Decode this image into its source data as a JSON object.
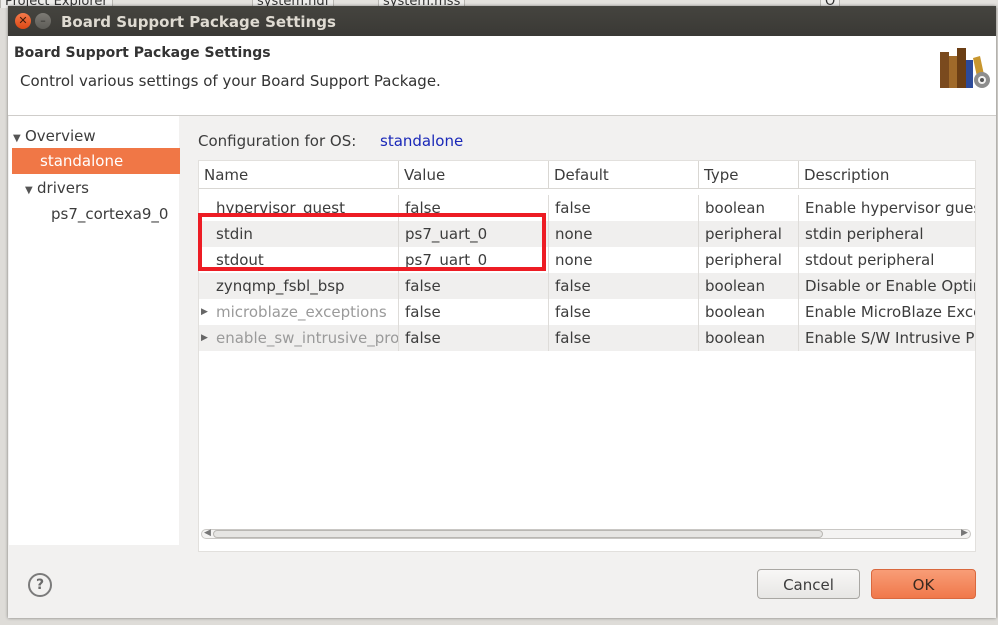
{
  "background": {
    "tabs": [
      "Project Explorer",
      "system.hdf",
      "system.mss",
      "O"
    ]
  },
  "dialog": {
    "title": "Board Support Package Settings",
    "header_title": "Board Support Package Settings",
    "header_description": "Control various settings of your Board Support Package."
  },
  "tree": {
    "items": [
      {
        "label": "Overview",
        "expanded": true,
        "level": 0
      },
      {
        "label": "standalone",
        "selected": true,
        "level": 1
      },
      {
        "label": "drivers",
        "expanded": true,
        "level": 1
      },
      {
        "label": "ps7_cortexa9_0",
        "level": 2
      }
    ]
  },
  "config": {
    "label": "Configuration for OS:",
    "os": "standalone"
  },
  "table": {
    "columns": [
      "Name",
      "Value",
      "Default",
      "Type",
      "Description"
    ],
    "rows": [
      {
        "name": "hypervisor_guest",
        "value": "false",
        "default": "false",
        "type": "boolean",
        "description": "Enable hypervisor guest"
      },
      {
        "name": "stdin",
        "value": "ps7_uart_0",
        "default": "none",
        "type": "peripheral",
        "description": "stdin peripheral"
      },
      {
        "name": "stdout",
        "value": "ps7_uart_0",
        "default": "none",
        "type": "peripheral",
        "description": "stdout peripheral"
      },
      {
        "name": "zynqmp_fsbl_bsp",
        "value": "false",
        "default": "false",
        "type": "boolean",
        "description": "Disable or Enable Optim"
      },
      {
        "name": "microblaze_exceptions",
        "value": "false",
        "default": "false",
        "type": "boolean",
        "description": "Enable MicroBlaze Excep"
      },
      {
        "name": "enable_sw_intrusive_profi",
        "value": "false",
        "default": "false",
        "type": "boolean",
        "description": "Enable S/W Intrusive Pro"
      }
    ]
  },
  "buttons": {
    "help": "?",
    "cancel": "Cancel",
    "ok": "OK"
  },
  "colors": {
    "accent": "#f07746",
    "highlight_box": "#ed1c24",
    "link": "#1a28b8"
  }
}
